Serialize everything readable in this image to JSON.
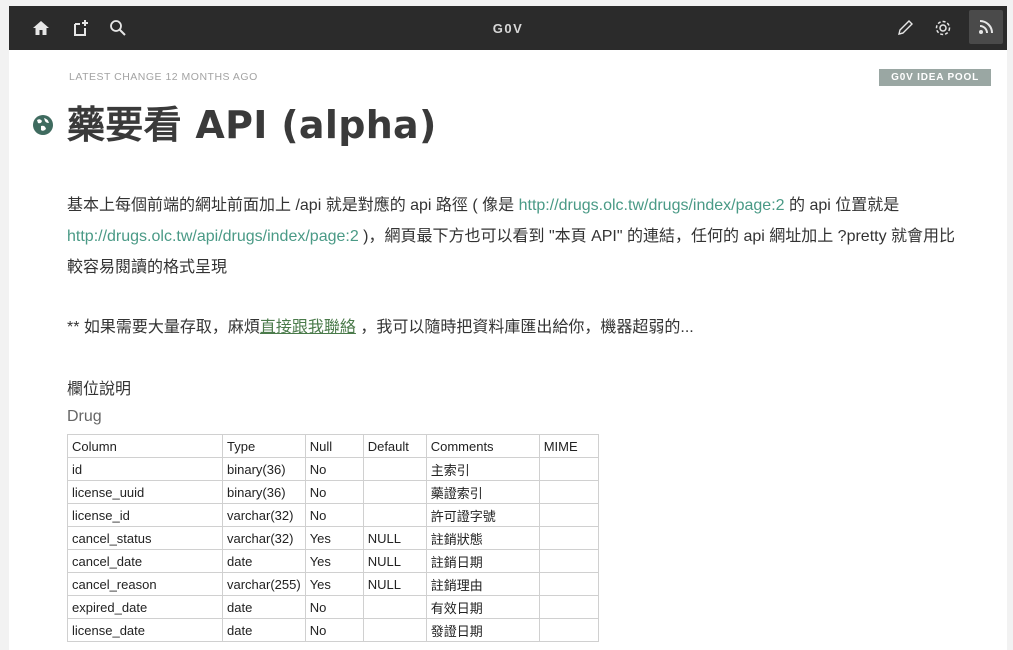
{
  "topbar": {
    "brand": "G0V",
    "icons": [
      "home-icon",
      "new-page-icon",
      "search-icon",
      "edit-icon",
      "settings-icon",
      "rss-icon"
    ]
  },
  "meta": {
    "latest_change": "LATEST CHANGE 12 MONTHS AGO",
    "tag": "G0V IDEA POOL"
  },
  "page": {
    "title": "藥要看 API (alpha)"
  },
  "para1": {
    "t1": "基本上每個前端的網址前面加上 /api 就是對應的 api 路徑 ( 像是 ",
    "link1": "http://drugs.olc.tw/drugs/index/page:2",
    "t2": " 的 api 位置就是 ",
    "link2": "http://drugs.olc.tw/api/drugs/index/page:2",
    "t3": " )，網頁最下方也可以看到 \"本頁 API\" 的連結，任何的 api 網址加上 ?pretty 就會用比較容易閱讀的格式呈現"
  },
  "para2": {
    "t1": "** 如果需要大量存取，麻煩",
    "link": "直接跟我聯絡",
    "t2": " ，我可以隨時把資料庫匯出給你，機器超弱的..."
  },
  "section_title": "欄位說明",
  "table_title": "Drug",
  "table": {
    "headers": [
      "Column",
      "Type",
      "Null",
      "Default",
      "Comments",
      "MIME"
    ],
    "rows": [
      [
        "id",
        "binary(36)",
        "No",
        "",
        "主索引",
        ""
      ],
      [
        "license_uuid",
        "binary(36)",
        "No",
        "",
        "藥證索引",
        ""
      ],
      [
        "license_id",
        "varchar(32)",
        "No",
        "",
        "許可證字號",
        ""
      ],
      [
        "cancel_status",
        "varchar(32)",
        "Yes",
        "NULL",
        "註銷狀態",
        ""
      ],
      [
        "cancel_date",
        "date",
        "Yes",
        "NULL",
        "註銷日期",
        ""
      ],
      [
        "cancel_reason",
        "varchar(255)",
        "Yes",
        "NULL",
        "註銷理由",
        ""
      ],
      [
        "expired_date",
        "date",
        "No",
        "",
        "有效日期",
        ""
      ],
      [
        "license_date",
        "date",
        "No",
        "",
        "發證日期",
        ""
      ]
    ]
  }
}
